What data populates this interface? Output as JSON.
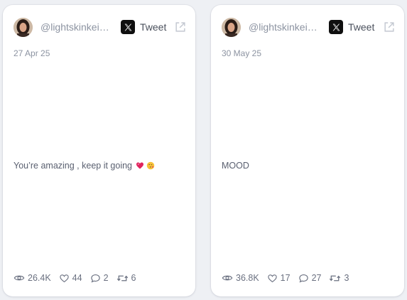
{
  "cards": [
    {
      "handle": "@lightskinkeisha",
      "platform_label": "Tweet",
      "date": "27 Apr 25",
      "text": "You’re amazing , keep it going",
      "emojis": [
        "heart-icon",
        "kissing-face-icon"
      ],
      "stats": {
        "views": "26.4K",
        "likes": "44",
        "replies": "2",
        "retweets": "6"
      }
    },
    {
      "handle": "@lightskinkeisha",
      "platform_label": "Tweet",
      "date": "30 May 25",
      "text": "MOOD",
      "emojis": [],
      "stats": {
        "views": "36.8K",
        "likes": "17",
        "replies": "27",
        "retweets": "3"
      }
    }
  ],
  "colors": {
    "background": "#eef0f4",
    "card": "#ffffff",
    "muted_text": "#8c93a1",
    "body_text": "#5a6070",
    "heart": "#e0245e",
    "x_logo": "#0f0f0f"
  }
}
